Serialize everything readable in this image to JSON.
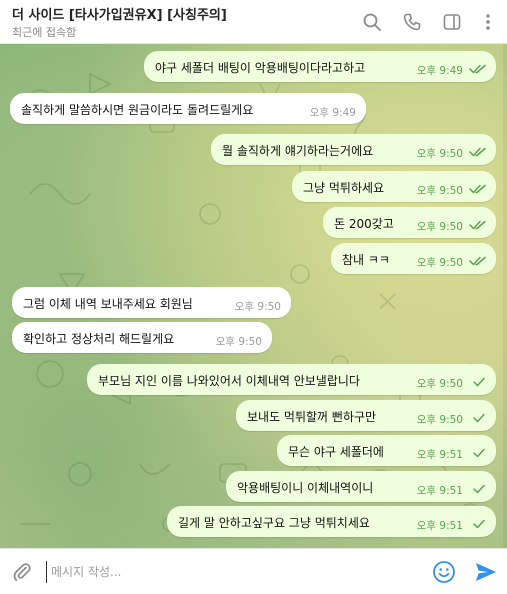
{
  "header": {
    "title": "더 사이드 [타사가입권유X] [사칭주의]",
    "status": "최근에 접속함",
    "icons": [
      "search-icon",
      "phone-icon",
      "sidebar-icon",
      "more-icon"
    ]
  },
  "colors": {
    "outgoing_bubble": "#effedd",
    "incoming_bubble": "#ffffff",
    "tick_color": "#5aa24f",
    "send_color": "#3390ec"
  },
  "messages": [
    {
      "text": "야구 세폴더 배팅이 악용배팅이다라고하고",
      "time": "오후 9:49",
      "direction": "out",
      "status": "read"
    },
    {
      "text": "솔직하게 말씀하시면 원금이라도 돌려드릴게요",
      "time": "오후 9:49",
      "direction": "in"
    },
    {
      "text": "뭘 솔직하게 얘기하라는거에요",
      "time": "오후 9:50",
      "direction": "out",
      "status": "read"
    },
    {
      "text": "그냥 먹튀하세요",
      "time": "오후 9:50",
      "direction": "out",
      "status": "read"
    },
    {
      "text": "돈 200갖고",
      "time": "오후 9:50",
      "direction": "out",
      "status": "read"
    },
    {
      "text": "참내 ㅋㅋ",
      "time": "오후 9:50",
      "direction": "out",
      "status": "read"
    },
    {
      "text": "그럼 이체 내역 보내주세요 회원님",
      "time": "오후 9:50",
      "direction": "in"
    },
    {
      "text": "확인하고 정상처리 해드릴게요",
      "time": "오후 9:50",
      "direction": "in"
    },
    {
      "text": "부모님 지인 이름 나와있어서 이체내역 안보낼랍니다",
      "time": "오후 9:50",
      "direction": "out",
      "status": "sent"
    },
    {
      "text": "보내도 먹튀할꺼 뻔하구만",
      "time": "오후 9:50",
      "direction": "out",
      "status": "sent"
    },
    {
      "text": "무슨 야구 세폴더에",
      "time": "오후 9:51",
      "direction": "out",
      "status": "sent"
    },
    {
      "text": "악용배팅이니 이체내역이니",
      "time": "오후 9:51",
      "direction": "out",
      "status": "sent"
    },
    {
      "text": "길게 말 안하고싶구요 그냥 먹튀치세요",
      "time": "오후 9:51",
      "direction": "out",
      "status": "sent"
    }
  ],
  "composer": {
    "placeholder": "메시지 작성...",
    "value": ""
  }
}
